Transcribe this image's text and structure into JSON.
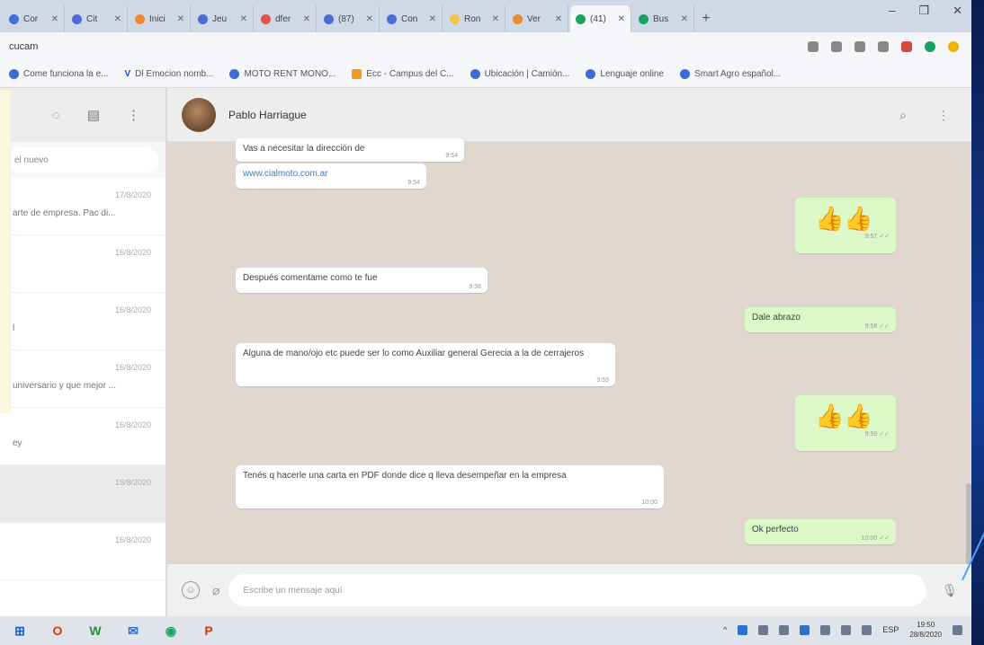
{
  "browser": {
    "tabs": [
      {
        "label": "Cor",
        "fav": "b"
      },
      {
        "label": "Cit",
        "fav": "b"
      },
      {
        "label": "Inici",
        "fav": "o"
      },
      {
        "label": "Jeu",
        "fav": "b"
      },
      {
        "label": "dfer",
        "fav": "r"
      },
      {
        "label": "(87)",
        "fav": "b"
      },
      {
        "label": "Con",
        "fav": "b"
      },
      {
        "label": "Ron",
        "fav": "y"
      },
      {
        "label": "Ver",
        "fav": "o"
      },
      {
        "label": "(41)",
        "fav": "g"
      },
      {
        "label": "Bus",
        "fav": "g"
      }
    ],
    "new_tab": "+",
    "window_controls": [
      "–",
      "❐",
      "✕"
    ],
    "address": "cucam",
    "bookmarks": [
      {
        "label": "Come funciona la e...",
        "icon": "globe-icon"
      },
      {
        "label": "Dl Emocion nomb...",
        "icon": "v-icon"
      },
      {
        "label": "MOTO RENT MONO...",
        "icon": "globe-icon"
      },
      {
        "label": "Ecc - Campus del C...",
        "icon": "folder-icon"
      },
      {
        "label": "Ubicación | Camión...",
        "icon": "globe-icon"
      },
      {
        "label": "Lenguaje online",
        "icon": "globe-icon"
      },
      {
        "label": "Smart Agro español...",
        "icon": "globe-icon"
      }
    ]
  },
  "sidebar": {
    "search_placeholder": "el nuevo",
    "chats": [
      {
        "preview": "arte de empresa. Pac di...",
        "time": "17/8/2020",
        "selected": false
      },
      {
        "preview": "",
        "time": "16/8/2020",
        "selected": false
      },
      {
        "preview": "l",
        "time": "16/8/2020",
        "selected": false
      },
      {
        "preview": "universario y que mejor ...",
        "time": "16/8/2020",
        "selected": false
      },
      {
        "preview": "ey",
        "time": "16/8/2020",
        "selected": false
      },
      {
        "preview": "",
        "time": "16/8/2020",
        "selected": true
      },
      {
        "preview": "",
        "time": "16/8/2020",
        "selected": false
      }
    ]
  },
  "chat": {
    "contact_name": "Pablo Harriague",
    "messages": [
      {
        "type": "in",
        "text": "Vas a necesitar la dirección de",
        "time": "9:54"
      },
      {
        "type": "in",
        "link": true,
        "text": "www.cialmoto.com.ar",
        "time": "9:54"
      },
      {
        "type": "out",
        "emoji": true,
        "text": "👍👍",
        "time": "9:57 ✓✓"
      },
      {
        "type": "in",
        "text": "Después comentame como te fue",
        "time": "9:58"
      },
      {
        "type": "out",
        "text": "Dale abrazo",
        "time": "9:58 ✓✓"
      },
      {
        "type": "in",
        "text": "Alguna de mano/ojo etc puede ser lo como Auxiliar general Gerecia a la de cerrajeros",
        "time": "9:59"
      },
      {
        "type": "out",
        "emoji": true,
        "text": "👍👍",
        "time": "9:59 ✓✓"
      },
      {
        "type": "in",
        "text": "Tenés q hacerle una carta en PDF donde dice q lleva desempeñar en la empresa",
        "time": "10:00"
      },
      {
        "type": "out",
        "text": "Ok perfecto",
        "time": "10:00 ✓✓"
      }
    ],
    "composer_placeholder": "Escribe un mensaje aquí"
  },
  "taskbar": {
    "apps": [
      "⊞",
      "O",
      "W",
      "✉",
      "◉",
      "P"
    ],
    "tray_lang": "ESP",
    "clock_time": "19:50",
    "clock_date": "28/8/2020"
  }
}
